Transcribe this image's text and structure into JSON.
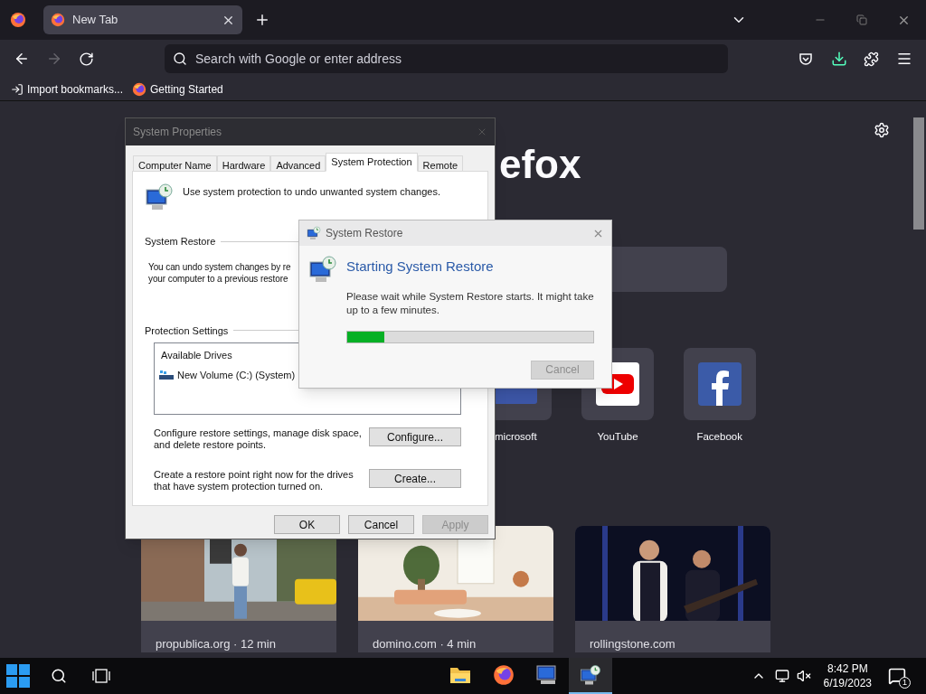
{
  "browser": {
    "tabs": [
      {
        "title": "New Tab",
        "selected": true
      }
    ],
    "nav": {
      "back_disabled": false,
      "forward_disabled": true
    },
    "address_bar": {
      "placeholder": "Search with Google or enter address"
    },
    "bookmarks": [
      {
        "label": "Import bookmarks...",
        "kind": "import"
      },
      {
        "label": "Getting Started",
        "kind": "firefox"
      }
    ]
  },
  "new_tab": {
    "logo_text": "efox",
    "shortcuts": [
      {
        "label": "microsoft",
        "kind": "microsoft"
      },
      {
        "label": "YouTube",
        "kind": "youtube"
      },
      {
        "label": "Facebook",
        "kind": "facebook"
      }
    ],
    "stories": [
      {
        "source": "propublica.org · 12 min",
        "kind": "street"
      },
      {
        "source": "domino.com · 4 min",
        "kind": "room"
      },
      {
        "source": "rollingstone.com",
        "kind": "stage"
      }
    ]
  },
  "system_properties": {
    "title": "System Properties",
    "tabs": [
      {
        "label": "Computer Name",
        "selected": false
      },
      {
        "label": "Hardware",
        "selected": false
      },
      {
        "label": "Advanced",
        "selected": false
      },
      {
        "label": "System Protection",
        "selected": true
      },
      {
        "label": "Remote",
        "selected": false
      }
    ],
    "intro": "Use system protection to undo unwanted system changes.",
    "restore_heading": "System Restore",
    "restore_text": [
      "You can undo system changes by re",
      "your computer to a previous restore"
    ],
    "protection_heading": "Protection Settings",
    "drives_column": "Available Drives",
    "drives": [
      {
        "name": "New Volume (C:) (System)"
      }
    ],
    "configure_text": "Configure restore settings, manage disk space, and delete restore points.",
    "configure_button": "Configure...",
    "create_text": "Create a restore point right now for the drives that have system protection turned on.",
    "create_button": "Create...",
    "buttons": [
      {
        "label": "OK",
        "disabled": false
      },
      {
        "label": "Cancel",
        "disabled": false
      },
      {
        "label": "Apply",
        "disabled": true
      }
    ]
  },
  "system_restore": {
    "title": "System Restore",
    "heading": "Starting System Restore",
    "message": "Please wait while System Restore starts. It might take up to a few minutes.",
    "progress": {
      "level": 0.15
    },
    "button": {
      "label": "Cancel",
      "disabled": true
    }
  },
  "taskbar": {
    "apps": [
      {
        "kind": "folder",
        "active": false
      },
      {
        "kind": "firefox",
        "active": false
      },
      {
        "kind": "computer",
        "active": false
      },
      {
        "kind": "restore",
        "active": true
      }
    ],
    "clock": {
      "time": "8:42 PM",
      "date": "6/19/2023"
    },
    "notifications": "1"
  }
}
